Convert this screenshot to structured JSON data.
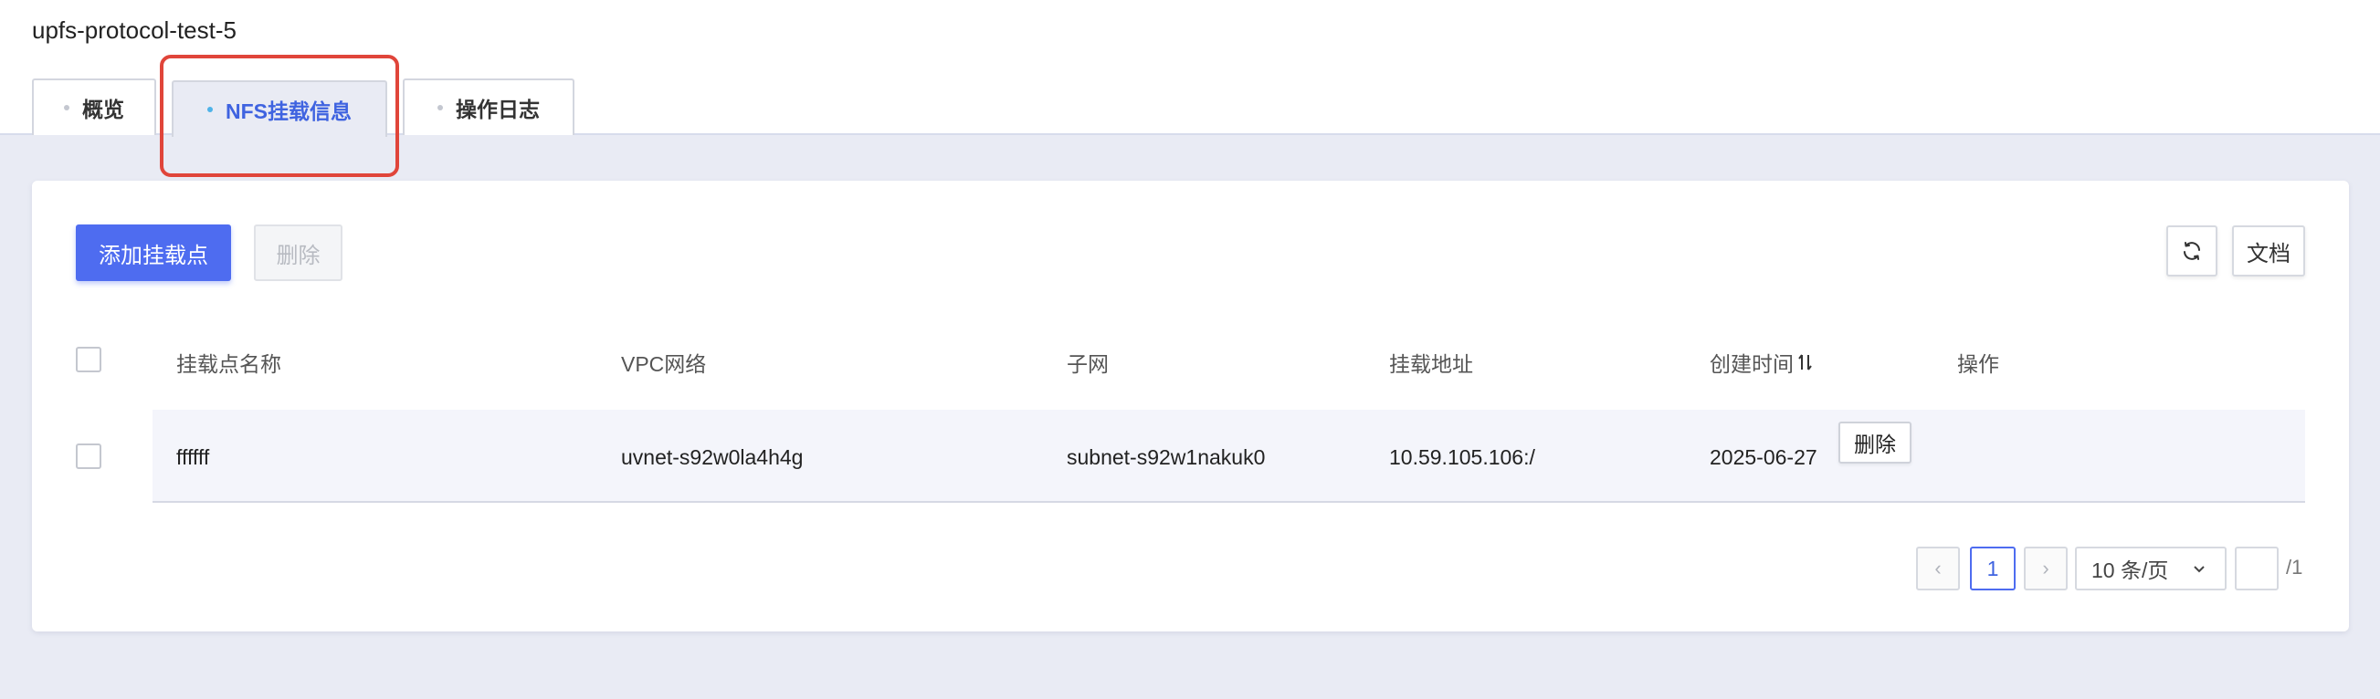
{
  "page_title": "upfs-protocol-test-5",
  "tabs": [
    {
      "label": "概览",
      "active": false
    },
    {
      "label": "NFS挂载信息",
      "active": true
    },
    {
      "label": "操作日志",
      "active": false
    }
  ],
  "toolbar": {
    "add_label": "添加挂载点",
    "delete_label": "删除",
    "refresh_icon": "refresh-icon",
    "doc_label": "文档"
  },
  "table": {
    "columns": [
      "挂载点名称",
      "VPC网络",
      "子网",
      "挂载地址",
      "创建时间",
      "操作"
    ],
    "sort_icon": "sort-icon",
    "rows": [
      {
        "name": "ffffff",
        "vpc": "uvnet-s92w0la4h4g",
        "subnet": "subnet-s92w1nakuk0",
        "address": "10.59.105.106:/",
        "created": "2025-06-27",
        "action_label": "删除"
      }
    ]
  },
  "pagination": {
    "prev": "‹",
    "current_page": "1",
    "next": "›",
    "page_size": "10 条/页",
    "total": "/1"
  },
  "colors": {
    "primary": "#4e6cf0",
    "highlight": "#e0453a",
    "active_tab_dot": "#4fb3e8"
  }
}
